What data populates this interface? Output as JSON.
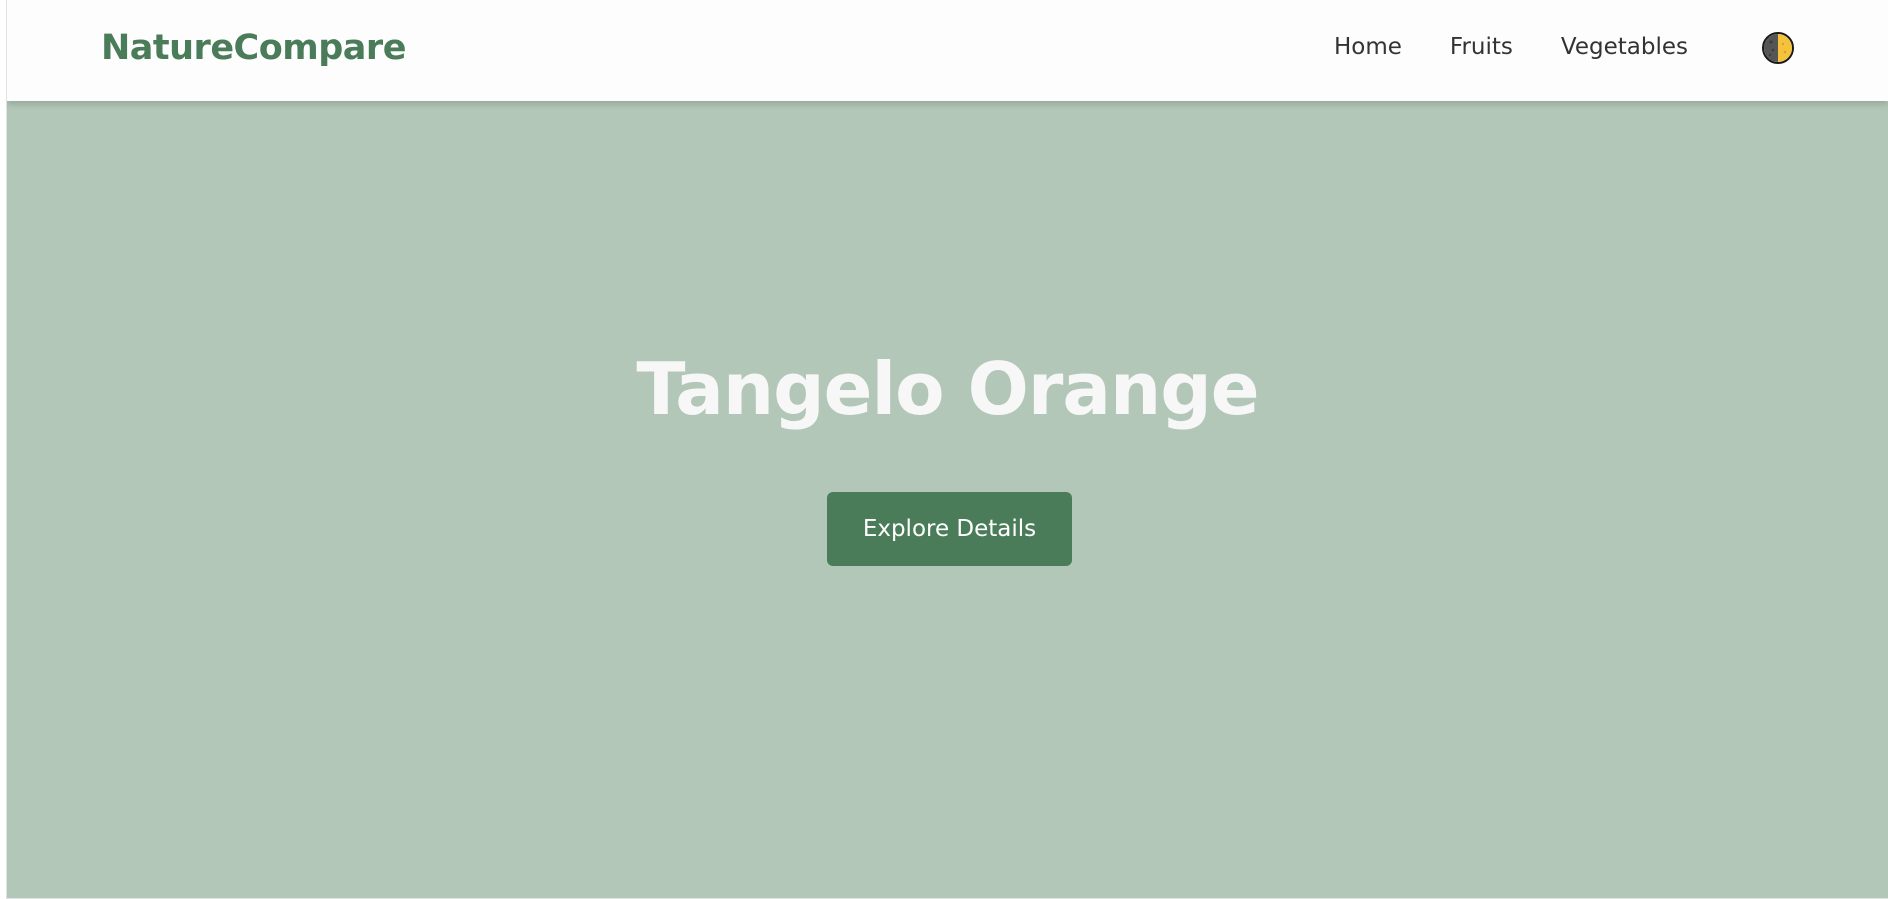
{
  "header": {
    "brand": "NatureCompare",
    "nav": [
      {
        "label": "Home"
      },
      {
        "label": "Fruits"
      },
      {
        "label": "Vegetables"
      }
    ],
    "theme_toggle_icon": "half-moon-theme-icon"
  },
  "hero": {
    "title": "Tangelo Orange",
    "button_label": "Explore Details"
  },
  "colors": {
    "brand": "#4a7c59",
    "hero_background": "#b2c7b8",
    "navbar_background": "#fdfdfd",
    "nav_text": "#333333",
    "hero_title": "#f7f7f7",
    "toggle_left": "#555555",
    "toggle_right": "#f6c23e"
  }
}
